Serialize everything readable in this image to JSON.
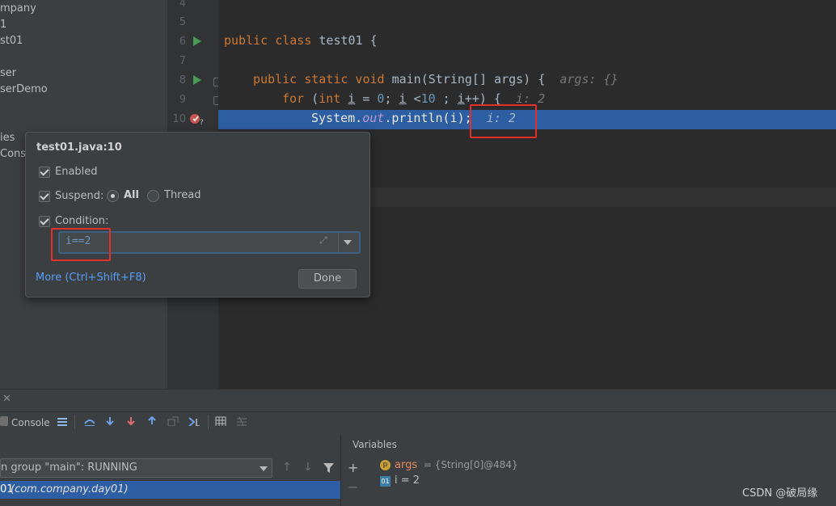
{
  "project_tree": [
    "mpany",
    "1",
    "st01",
    "ser",
    "serDemo",
    "ies",
    "Conso"
  ],
  "line_numbers": [
    "4",
    "5",
    "6",
    "7",
    "8",
    "9",
    "10"
  ],
  "code": {
    "l6_kw": "public class",
    "l6_rest": " test01 {",
    "l8_kw": "public static void",
    "l8_rest": " main(String[] args) {",
    "l8_hint": "args: {}",
    "l9_kw": "for",
    "l9_open": " (",
    "l9_int": "int",
    "l9_i": "i",
    "l9_eq": " = ",
    "l9_zero": "0",
    "l9_semi": "; ",
    "l9_i2": "i",
    "l9_lt": " <",
    "l9_ten": "10",
    "l9_semi2": " ; ",
    "l9_i3": "i",
    "l9_tail": "++) {",
    "l9_hint": "i: 2",
    "l10_sys": "System.",
    "l10_out": "out",
    "l10_tail": ".println(i);",
    "l10_hint": "i: 2"
  },
  "popup": {
    "title": "test01.java:10",
    "enabled_label": "Enabled",
    "suspend_label": "Suspend:",
    "all_label": "All",
    "thread_label": "Thread",
    "condition_label": "Condition:",
    "condition_value": "i==2",
    "more_link": "More (Ctrl+Shift+F8)",
    "done_label": "Done"
  },
  "debug": {
    "console_label": "Console",
    "thread_group": "n group \"main\": RUNNING",
    "frame": "01",
    "frame_pkg": "(com.company.day01)",
    "variables_title": "Variables",
    "var_args_name": "args",
    "var_args_value": " = {String[0]@484}",
    "var_i": "i = 2"
  },
  "watermark": "CSDN @破局缘",
  "colors": {
    "accent": "#2d5ea3",
    "highlight": "#e0302a",
    "keyword": "#cc7832",
    "number": "#6897bb"
  }
}
